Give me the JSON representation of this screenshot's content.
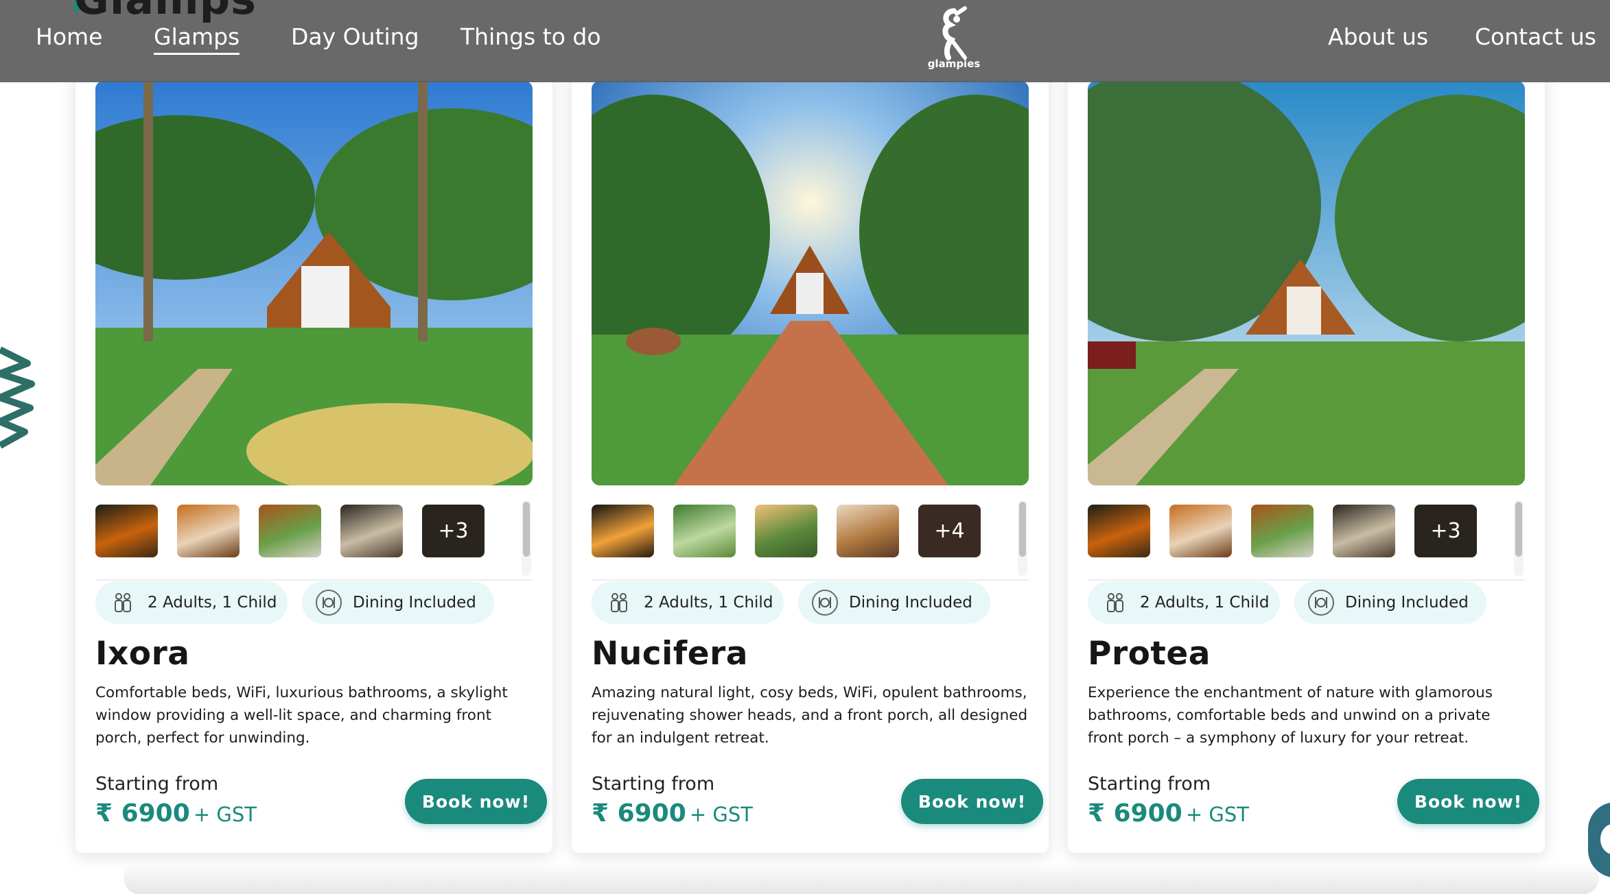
{
  "colors": {
    "accent": "#1a8a7c",
    "pill_bg": "#e8f7f7",
    "navbar_bg": "#5c5c5c"
  },
  "nav": {
    "section_peek": "Glamps",
    "links": [
      "Home",
      "Glamps",
      "Day Outing",
      "Things to do"
    ],
    "right_links": [
      "About us",
      "Contact us"
    ],
    "active": "Glamps",
    "logo_text": "glampies"
  },
  "cards": [
    {
      "name": "Ixora",
      "guests": "2 Adults, 1 Child",
      "dining": "Dining Included",
      "description": "Comfortable beds, WiFi, luxurious bathrooms, a skylight window providing a well-lit space, and charming front porch, perfect for unwinding.",
      "starting_label": "Starting from",
      "price": "₹ 6900",
      "price_suffix": "+ GST",
      "button": "Book now!",
      "more_photos": "+3"
    },
    {
      "name": "Nucifera",
      "guests": "2 Adults, 1 Child",
      "dining": "Dining Included",
      "description": "Amazing natural light, cosy beds, WiFi, opulent bathrooms, rejuvenating shower heads, and a front porch, all designed for an indulgent retreat.",
      "starting_label": "Starting from",
      "price": "₹ 6900",
      "price_suffix": "+ GST",
      "button": "Book now!",
      "more_photos": "+4"
    },
    {
      "name": "Protea",
      "guests": "2 Adults, 1 Child",
      "dining": "Dining Included",
      "description": "Experience the enchantment of nature with glamorous bathrooms, comfortable beds and unwind on a private front porch – a symphony of luxury for your retreat.",
      "starting_label": "Starting from",
      "price": "₹ 6900",
      "price_suffix": "+ GST",
      "button": "Book now!",
      "more_photos": "+3"
    }
  ]
}
